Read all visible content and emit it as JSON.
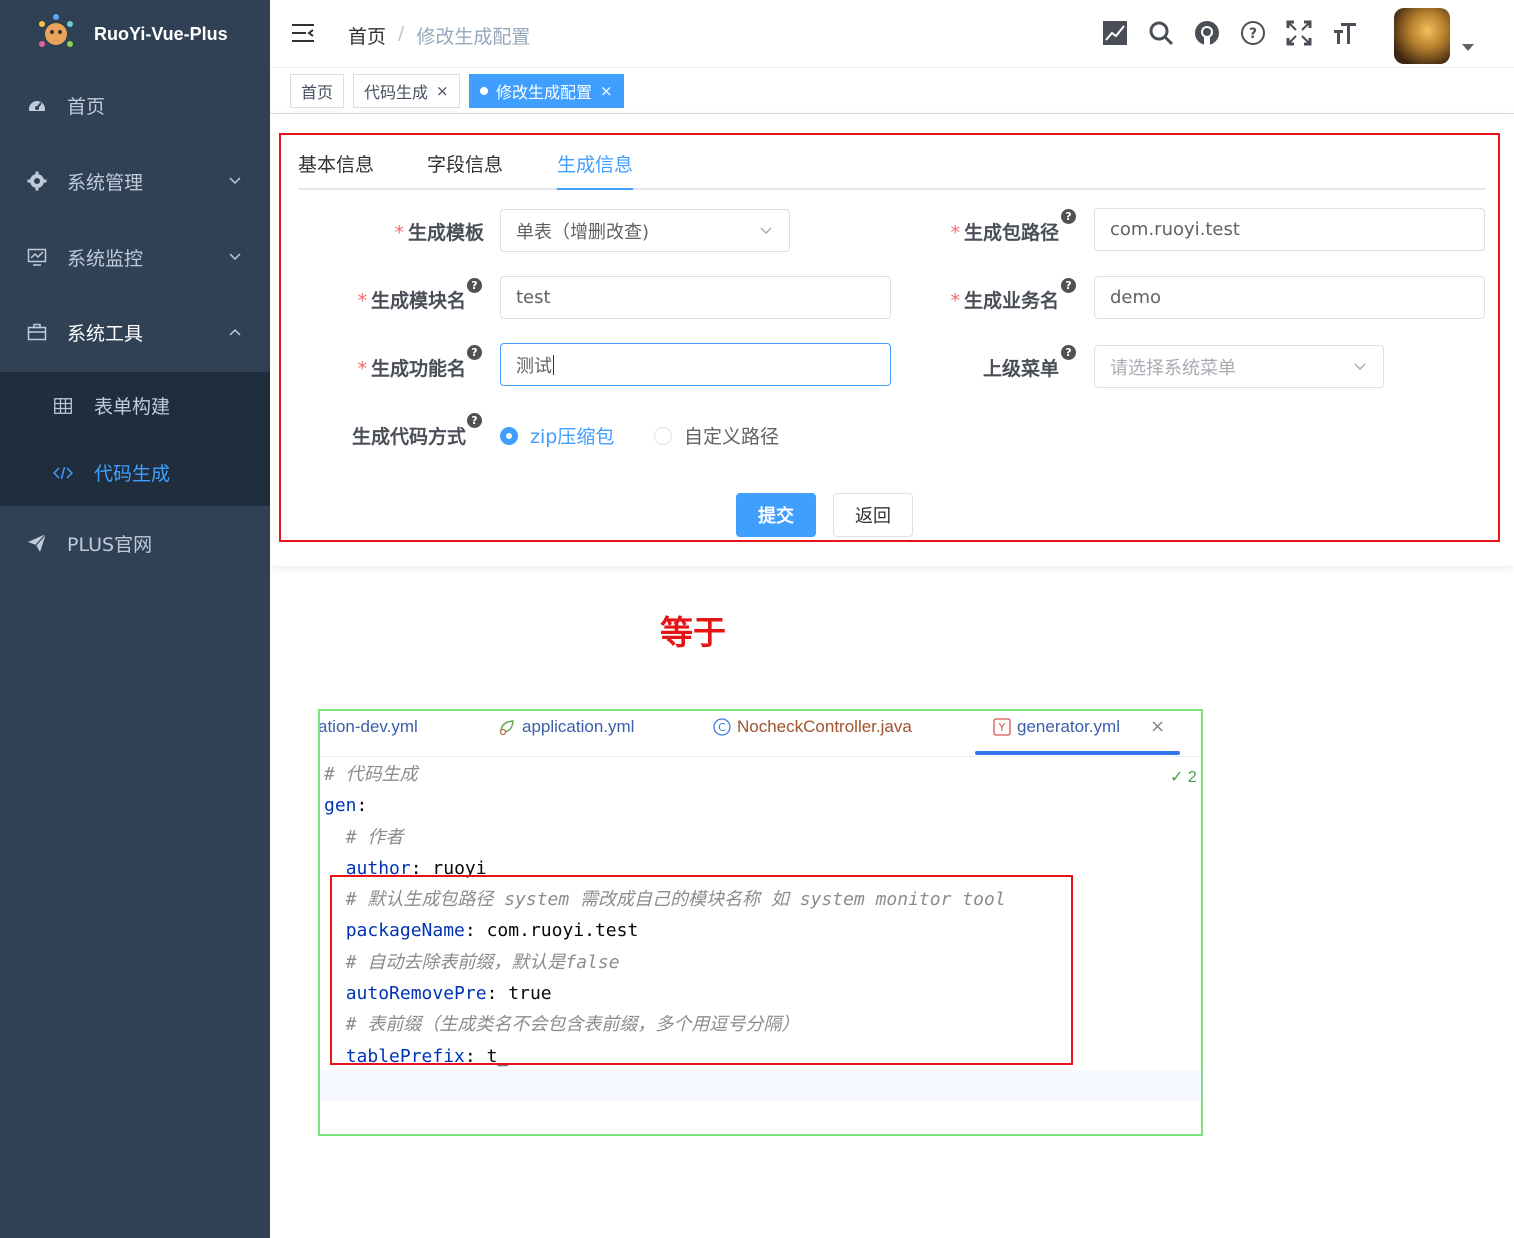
{
  "sidebar": {
    "brand": "RuoYi-Vue-Plus",
    "items": [
      {
        "label": "首页"
      },
      {
        "label": "系统管理"
      },
      {
        "label": "系统监控"
      },
      {
        "label": "系统工具"
      },
      {
        "label": "PLUS官网"
      }
    ],
    "sub_items": [
      {
        "label": "表单构建"
      },
      {
        "label": "代码生成"
      }
    ]
  },
  "navbar": {
    "breadcrumb": [
      "首页",
      "修改生成配置"
    ],
    "separator": "/",
    "icons": [
      "chart-icon",
      "search-icon",
      "github-icon",
      "help-icon",
      "fullscreen-icon",
      "font-size-icon"
    ]
  },
  "tags": [
    {
      "label": "首页"
    },
    {
      "label": "代码生成",
      "close": "×"
    },
    {
      "label": "修改生成配置",
      "close": "×"
    }
  ],
  "tabs": [
    "基本信息",
    "字段信息",
    "生成信息"
  ],
  "form": {
    "template": {
      "label": "生成模板",
      "value": "单表（增删改查)"
    },
    "package_path": {
      "label": "生成包路径",
      "value": "com.ruoyi.test"
    },
    "module_name": {
      "label": "生成模块名",
      "value": "test"
    },
    "business_name": {
      "label": "生成业务名",
      "value": "demo"
    },
    "function_name": {
      "label": "生成功能名",
      "value": "测试"
    },
    "parent_menu": {
      "label": "上级菜单",
      "placeholder": "请选择系统菜单"
    },
    "gen_type": {
      "label": "生成代码方式",
      "options": [
        "zip压缩包",
        "自定义路径"
      ]
    },
    "submit": "提交",
    "back": "返回",
    "required_mark": "*",
    "help_mark": "?"
  },
  "annotation": "等于",
  "ide": {
    "tabs": [
      "ation-dev.yml",
      "application.yml",
      "NocheckController.java",
      "generator.yml"
    ],
    "close": "×",
    "inspection": "2",
    "lines": [
      {
        "type": "comment",
        "indent": "",
        "text": "# 代码生成"
      },
      {
        "type": "key",
        "indent": "",
        "key": "gen",
        "value": ""
      },
      {
        "type": "comment",
        "indent": "  ",
        "text": "# 作者"
      },
      {
        "type": "key",
        "indent": "  ",
        "key": "author",
        "value": "ruoyi"
      },
      {
        "type": "comment",
        "indent": "  ",
        "text": "# 默认生成包路径 system 需改成自己的模块名称 如 system monitor tool"
      },
      {
        "type": "key",
        "indent": "  ",
        "key": "packageName",
        "value": "com.ruoyi.test"
      },
      {
        "type": "comment",
        "indent": "  ",
        "text": "# 自动去除表前缀，默认是false"
      },
      {
        "type": "key",
        "indent": "  ",
        "key": "autoRemovePre",
        "value": "true"
      },
      {
        "type": "comment",
        "indent": "  ",
        "text": "# 表前缀（生成类名不会包含表前缀，多个用逗号分隔）"
      },
      {
        "type": "key",
        "indent": "  ",
        "key": "tablePrefix",
        "value": "t_"
      }
    ]
  },
  "colors": {
    "sidebar_bg": "#304156",
    "submenu_bg": "#1f2d3d",
    "primary": "#409eff",
    "annotation_red": "#e7151b",
    "ide_border": "#7ee07e"
  }
}
